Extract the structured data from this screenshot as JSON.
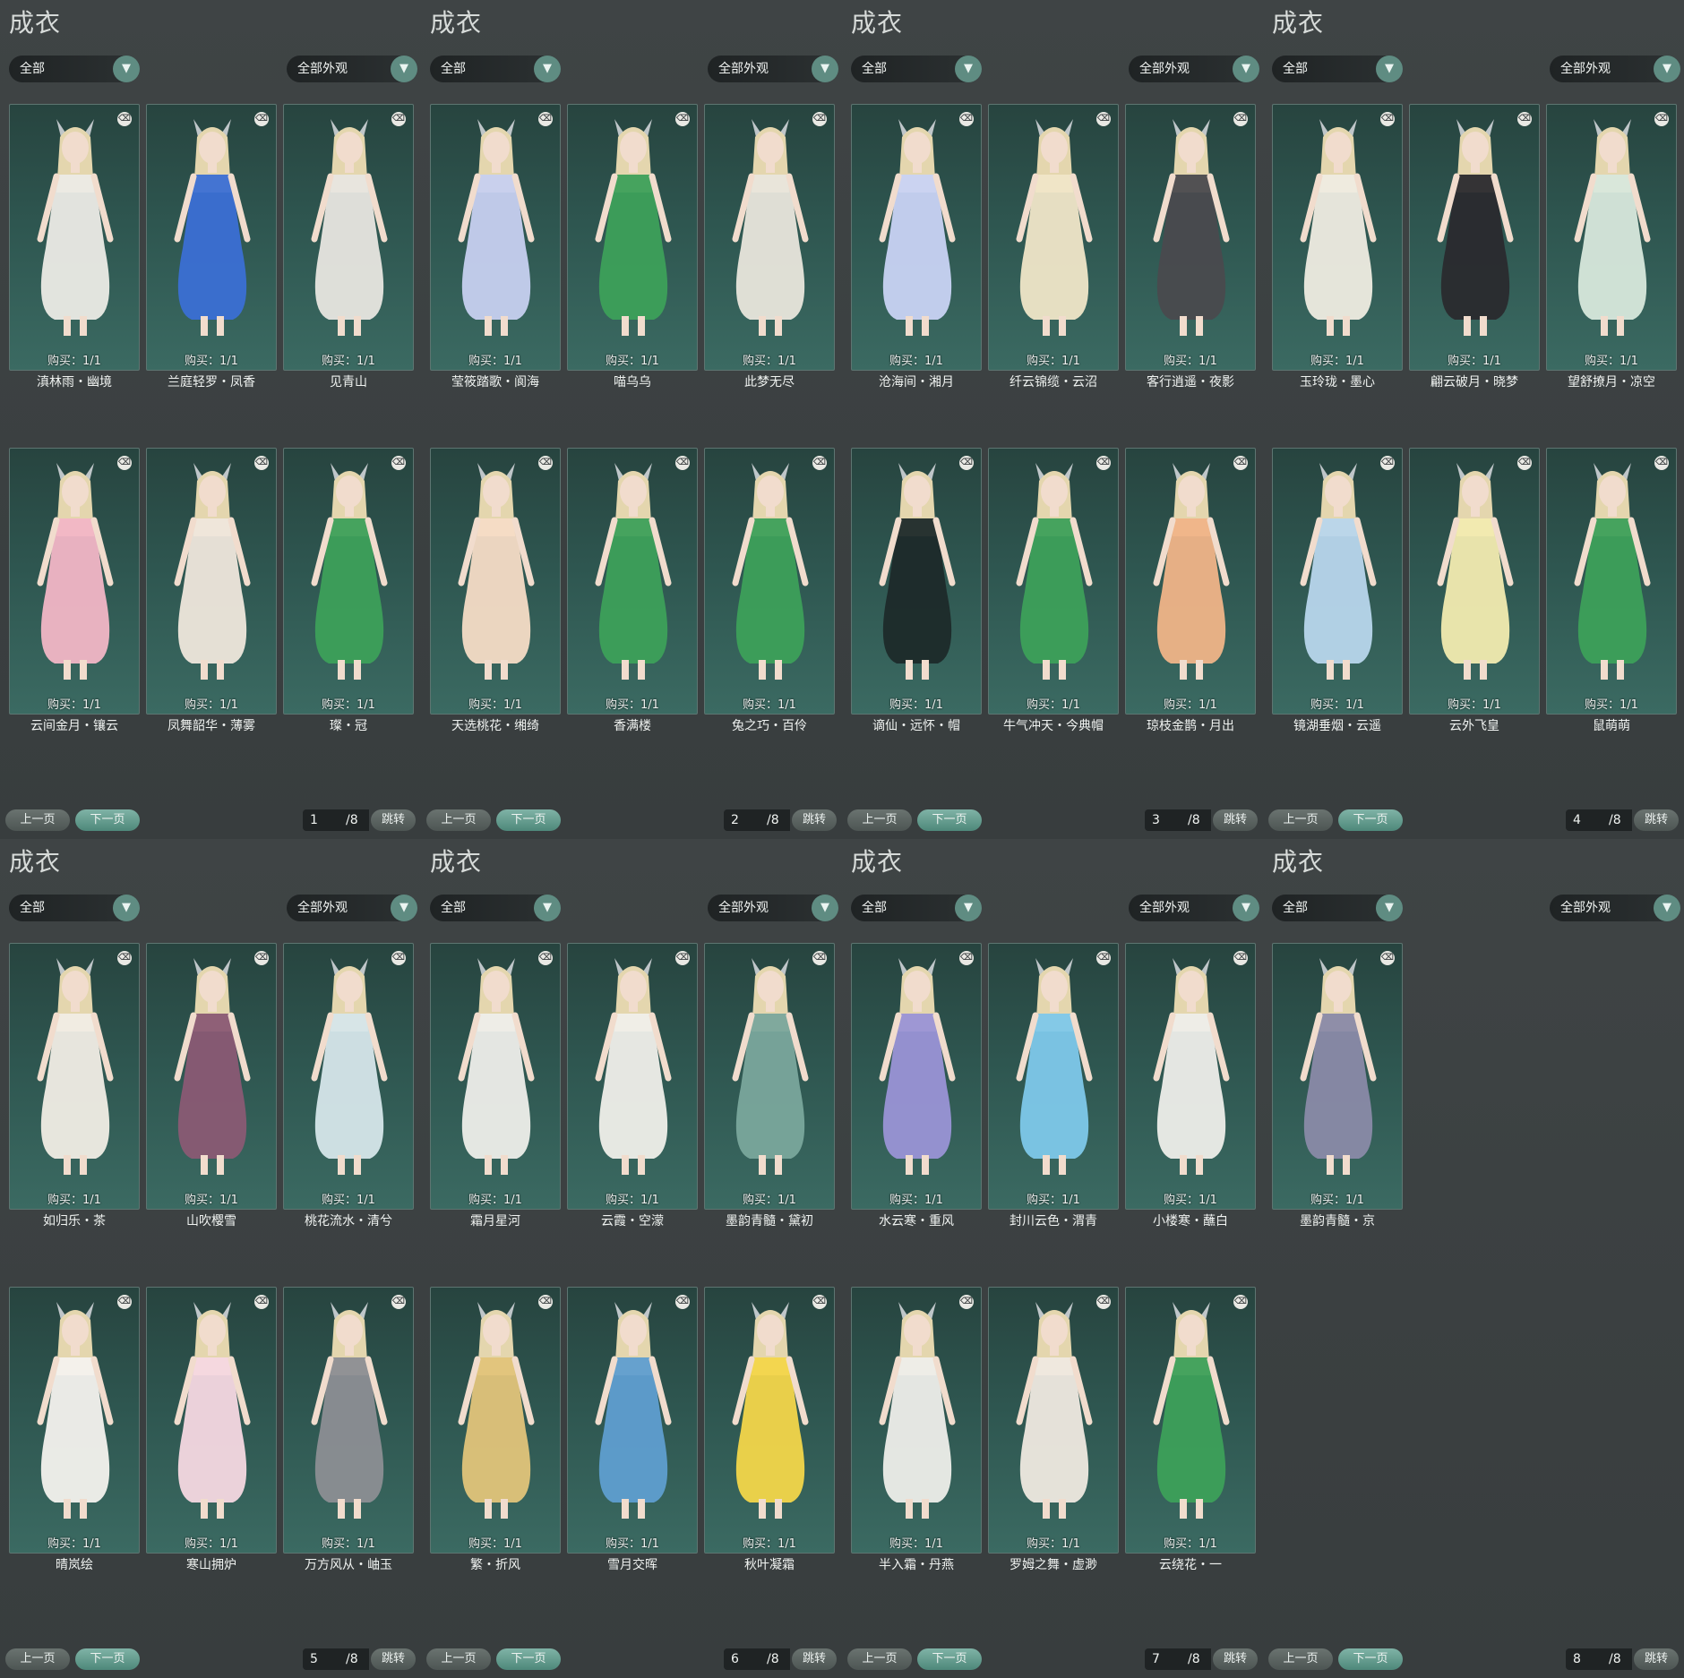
{
  "labels": {
    "title": "成衣",
    "filter": "全部",
    "appearance": "全部外观",
    "prev": "上一页",
    "next": "下一页",
    "jump": "跳转",
    "buy": "购买：1/1"
  },
  "pages": [
    {
      "page": "1",
      "total": "/8",
      "items": [
        "滇林雨・幽境",
        "兰庭轻罗・凤香",
        "见青山",
        "云间金月・镶云",
        "凤舞韶华・薄雾",
        "璨・冠"
      ]
    },
    {
      "page": "2",
      "total": "/8",
      "items": [
        "莹筱踏歌・阆海",
        "喵乌乌",
        "此梦无尽",
        "天选桃花・缃绮",
        "香满楼",
        "兔之巧・百伶"
      ]
    },
    {
      "page": "3",
      "total": "/8",
      "items": [
        "沧海间・湘月",
        "纤云锦缆・云沼",
        "客行逍遥・夜影",
        "谪仙・远怀・帽",
        "牛气冲天・今典帽",
        "琼枝金鹊・月出"
      ]
    },
    {
      "page": "4",
      "total": "/8",
      "items": [
        "玉玲珑・墨心",
        "翩云破月・晓梦",
        "望舒撩月・凉空",
        "镜湖垂烟・云遥",
        "云外飞皇",
        "鼠萌萌"
      ]
    },
    {
      "page": "5",
      "total": "/8",
      "items": [
        "如归乐・茶",
        "山吹樱雪",
        "桃花流水・清兮",
        "晴岚绘",
        "寒山拥炉",
        "万方风从・岫玉"
      ]
    },
    {
      "page": "6",
      "total": "/8",
      "items": [
        "霜月星河",
        "云霞・空濛",
        "墨韵青髓・黛初",
        "繁・折风",
        "雪月交晖",
        "秋叶凝霜"
      ]
    },
    {
      "page": "7",
      "total": "/8",
      "items": [
        "水云寒・重风",
        "封川云色・渭青",
        "小楼寒・蘸白",
        "半入霜・丹燕",
        "罗姆之舞・虚渺",
        "云绕花・一"
      ]
    },
    {
      "page": "8",
      "total": "/8",
      "items": [
        "墨韵青髓・京"
      ]
    }
  ],
  "outfit_colors": {
    "1": [
      "#ecebe6",
      "#3b6fd4",
      "#e8e6e0",
      "#f2b6c6",
      "#efe7dc",
      "#3da05a"
    ],
    "2": [
      "#c7d0f0",
      "#3da05a",
      "#e9e6dc",
      "#f5dcc6",
      "#3da05a",
      "#3da05a"
    ],
    "3": [
      "#c9d3f4",
      "#f0e6c8",
      "#4a4a4e",
      "#1e2a2a",
      "#3da05a",
      "#f0b488"
    ],
    "4": [
      "#efece2",
      "#2a2a2e",
      "#d8e8dc",
      "#b8d6ec",
      "#f2ebb0",
      "#3da05a"
    ],
    "5": [
      "#f1ede5",
      "#8a5a74",
      "#d6e6ea",
      "#f4f2ee",
      "#f6d8e2",
      "#8c8e94"
    ],
    "6": [
      "#eeeeea",
      "#f0efea",
      "#7aa69c",
      "#e2c47a",
      "#5f9ed0",
      "#f3d64a"
    ],
    "7": [
      "#9a94d6",
      "#7ec8ea",
      "#eeeeea",
      "#eeeeea",
      "#efe9e0",
      "#3da05a"
    ],
    "8": [
      "#8a8aa8"
    ]
  }
}
